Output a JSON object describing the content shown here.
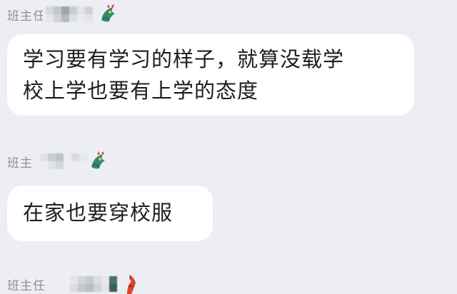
{
  "chat": {
    "messages": [
      {
        "sender_name": "班主任",
        "text_line1": "学习要有学习的样子，就算没载学",
        "text_line2": "校上学也要有上学的态度"
      },
      {
        "sender_name": "班主",
        "text_line1": "在家也要穿校服"
      },
      {
        "sender_name": "班主任"
      }
    ]
  },
  "colors": {
    "background": "#eceef4",
    "bubble": "#ffffff",
    "message_text": "#1b1c1f",
    "sender_name": "#8e9199",
    "badge_green": "#2e8b6a",
    "badge_red": "#d9452b"
  },
  "icons": {
    "avatar_badge": "dragon-badge-icon",
    "blurred_name": "pixelated-name-icon"
  }
}
